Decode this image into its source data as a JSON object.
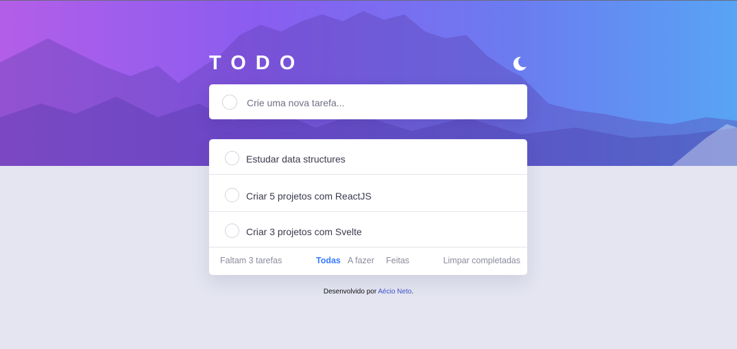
{
  "app": {
    "title": "TODO"
  },
  "colors": {
    "accent": "#3a7bfd",
    "background": "#e4e5f1",
    "hero_start": "#b35ee8",
    "hero_end": "#58a4f5"
  },
  "icons": {
    "theme_toggle": "moon-icon",
    "check": "circle-icon"
  },
  "new_todo": {
    "placeholder": "Crie uma nova tarefa...",
    "value": ""
  },
  "todos": [
    {
      "label": "Estudar data structures",
      "completed": false
    },
    {
      "label": "Criar 5 projetos com ReactJS",
      "completed": false
    },
    {
      "label": "Criar 3 projetos com Svelte",
      "completed": false
    }
  ],
  "footer": {
    "count": "Faltam 3 tarefas",
    "filters": [
      "Todas",
      "A fazer",
      "Feitas"
    ],
    "active_filter": "Todas",
    "clear": "Limpar completadas"
  },
  "credit": {
    "prefix": "Desenvolvido por",
    "author": "Aécio Neto",
    "suffix": "."
  }
}
